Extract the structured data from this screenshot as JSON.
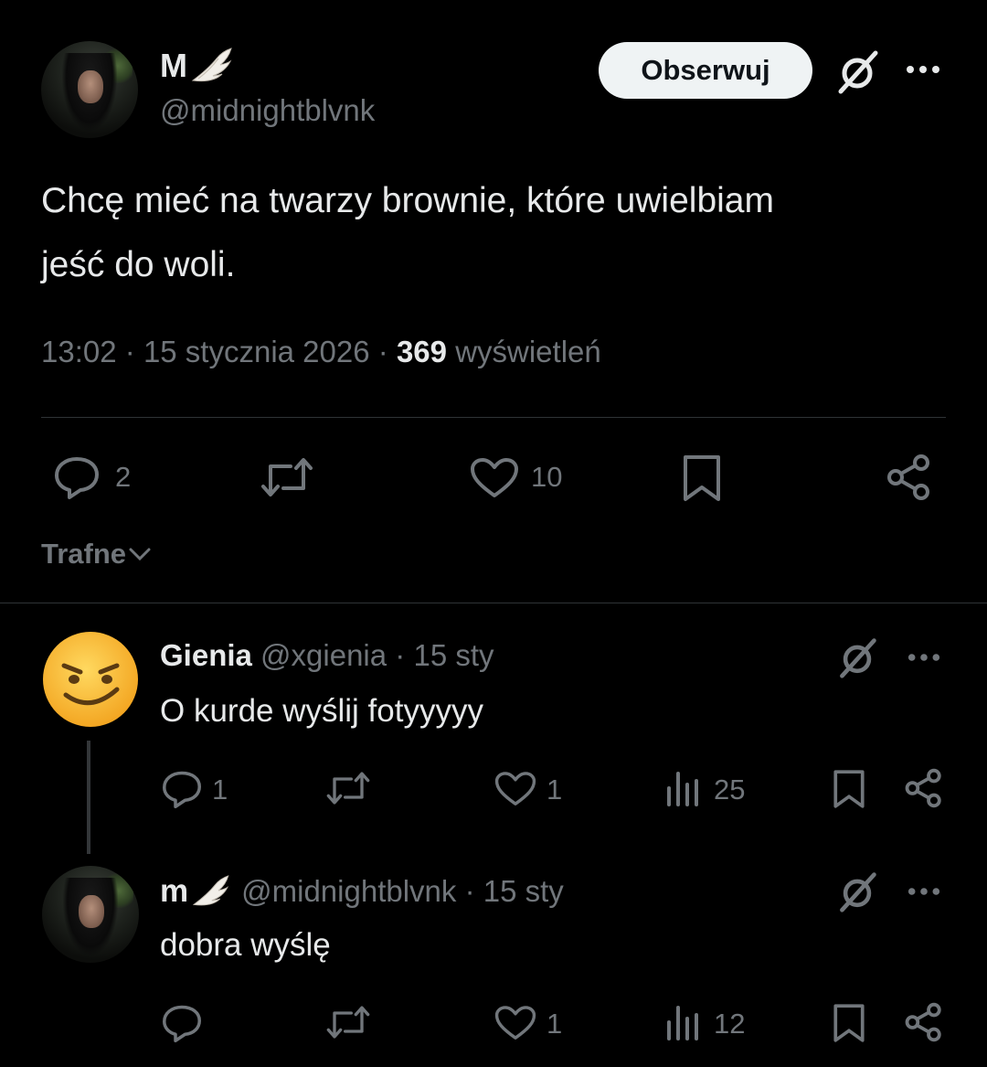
{
  "main_tweet": {
    "author_name": "M",
    "author_handle": "@midnightblvnk",
    "follow_label": "Obserwuj",
    "text_line1": "Chcę mieć na twarzy brownie, które uwielbiam",
    "text_line2": "jeść do woli.",
    "time": "13:02",
    "date": "15 stycznia 2026",
    "views_count": "369",
    "views_label": "wyświetleń",
    "replies": "2",
    "likes": "10"
  },
  "sort": {
    "label": "Trafne"
  },
  "replies": [
    {
      "author_name": "Gienia",
      "author_handle": "@xgienia",
      "date": "15 sty",
      "text": "O kurde wyślij fotyyyyy",
      "replies": "1",
      "likes": "1",
      "views": "25"
    },
    {
      "author_name": "m",
      "author_handle": "@midnightblvnk",
      "date": "15 sty",
      "text": "dobra wyślę",
      "likes": "1",
      "views": "12"
    }
  ],
  "icons": [
    "wing-emoji-icon",
    "grok-icon",
    "more-icon",
    "reply-icon",
    "retweet-icon",
    "like-icon",
    "bookmark-icon",
    "share-icon",
    "views-icon",
    "chevron-down-icon",
    "smirk-emoji-icon"
  ]
}
